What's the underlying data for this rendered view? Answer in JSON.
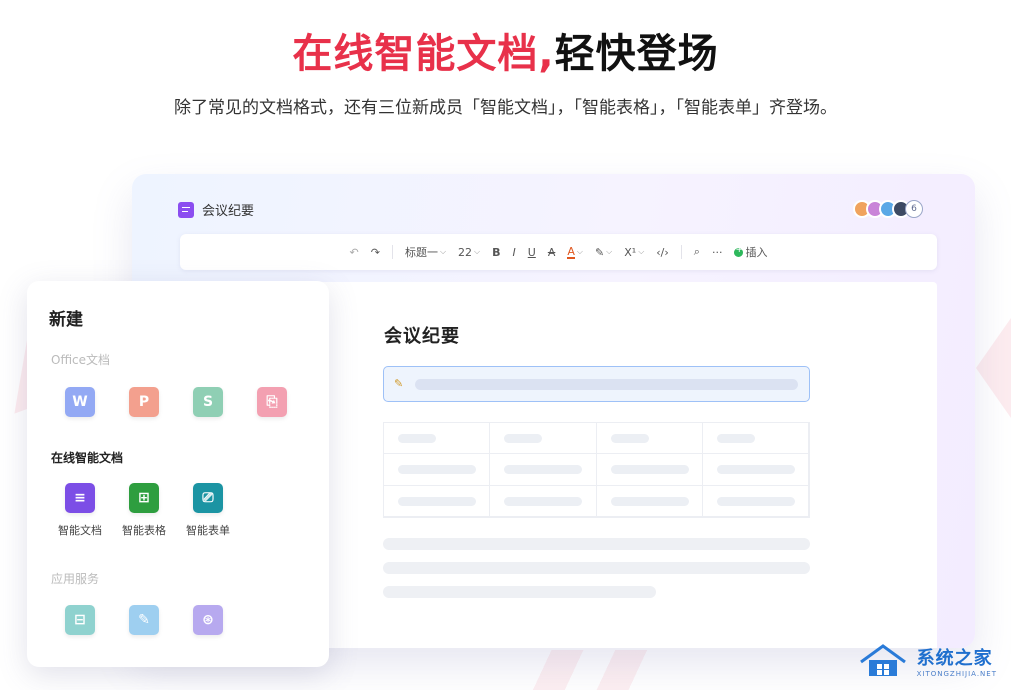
{
  "hero": {
    "title_accent": "在线智能文档,",
    "title_rest": "轻快登场",
    "subtitle": "除了常见的文档格式，还有三位新成员「智能文档」，「智能表格」，「智能表单」齐登场。"
  },
  "editor": {
    "doc_name": "会议纪要",
    "collaborator_count": "6",
    "toolbar": {
      "heading_style": "标题一",
      "font_size": "22",
      "bold": "B",
      "italic": "I",
      "underline": "U",
      "strike": "A",
      "font_color": "A",
      "superscript": "X¹",
      "code": "‹/›",
      "more": "···",
      "insert": "插入"
    },
    "page_heading": "会议纪要"
  },
  "new_panel": {
    "title": "新建",
    "office_section": "Office文档",
    "office_apps": [
      {
        "glyph": "W"
      },
      {
        "glyph": "P"
      },
      {
        "glyph": "S"
      },
      {
        "glyph": "⎘"
      }
    ],
    "smart_section": "在线智能文档",
    "smart_apps": [
      {
        "glyph": "≡",
        "label": "智能文档"
      },
      {
        "glyph": "⊞",
        "label": "智能表格"
      },
      {
        "glyph": "⎚",
        "label": "智能表单"
      }
    ],
    "services_section": "应用服务",
    "service_apps": [
      {
        "glyph": "⊟"
      },
      {
        "glyph": "✎"
      },
      {
        "glyph": "⊛"
      }
    ]
  },
  "watermark": {
    "name": "系统之家",
    "domain": "XITONGZHIJIA.NET"
  }
}
